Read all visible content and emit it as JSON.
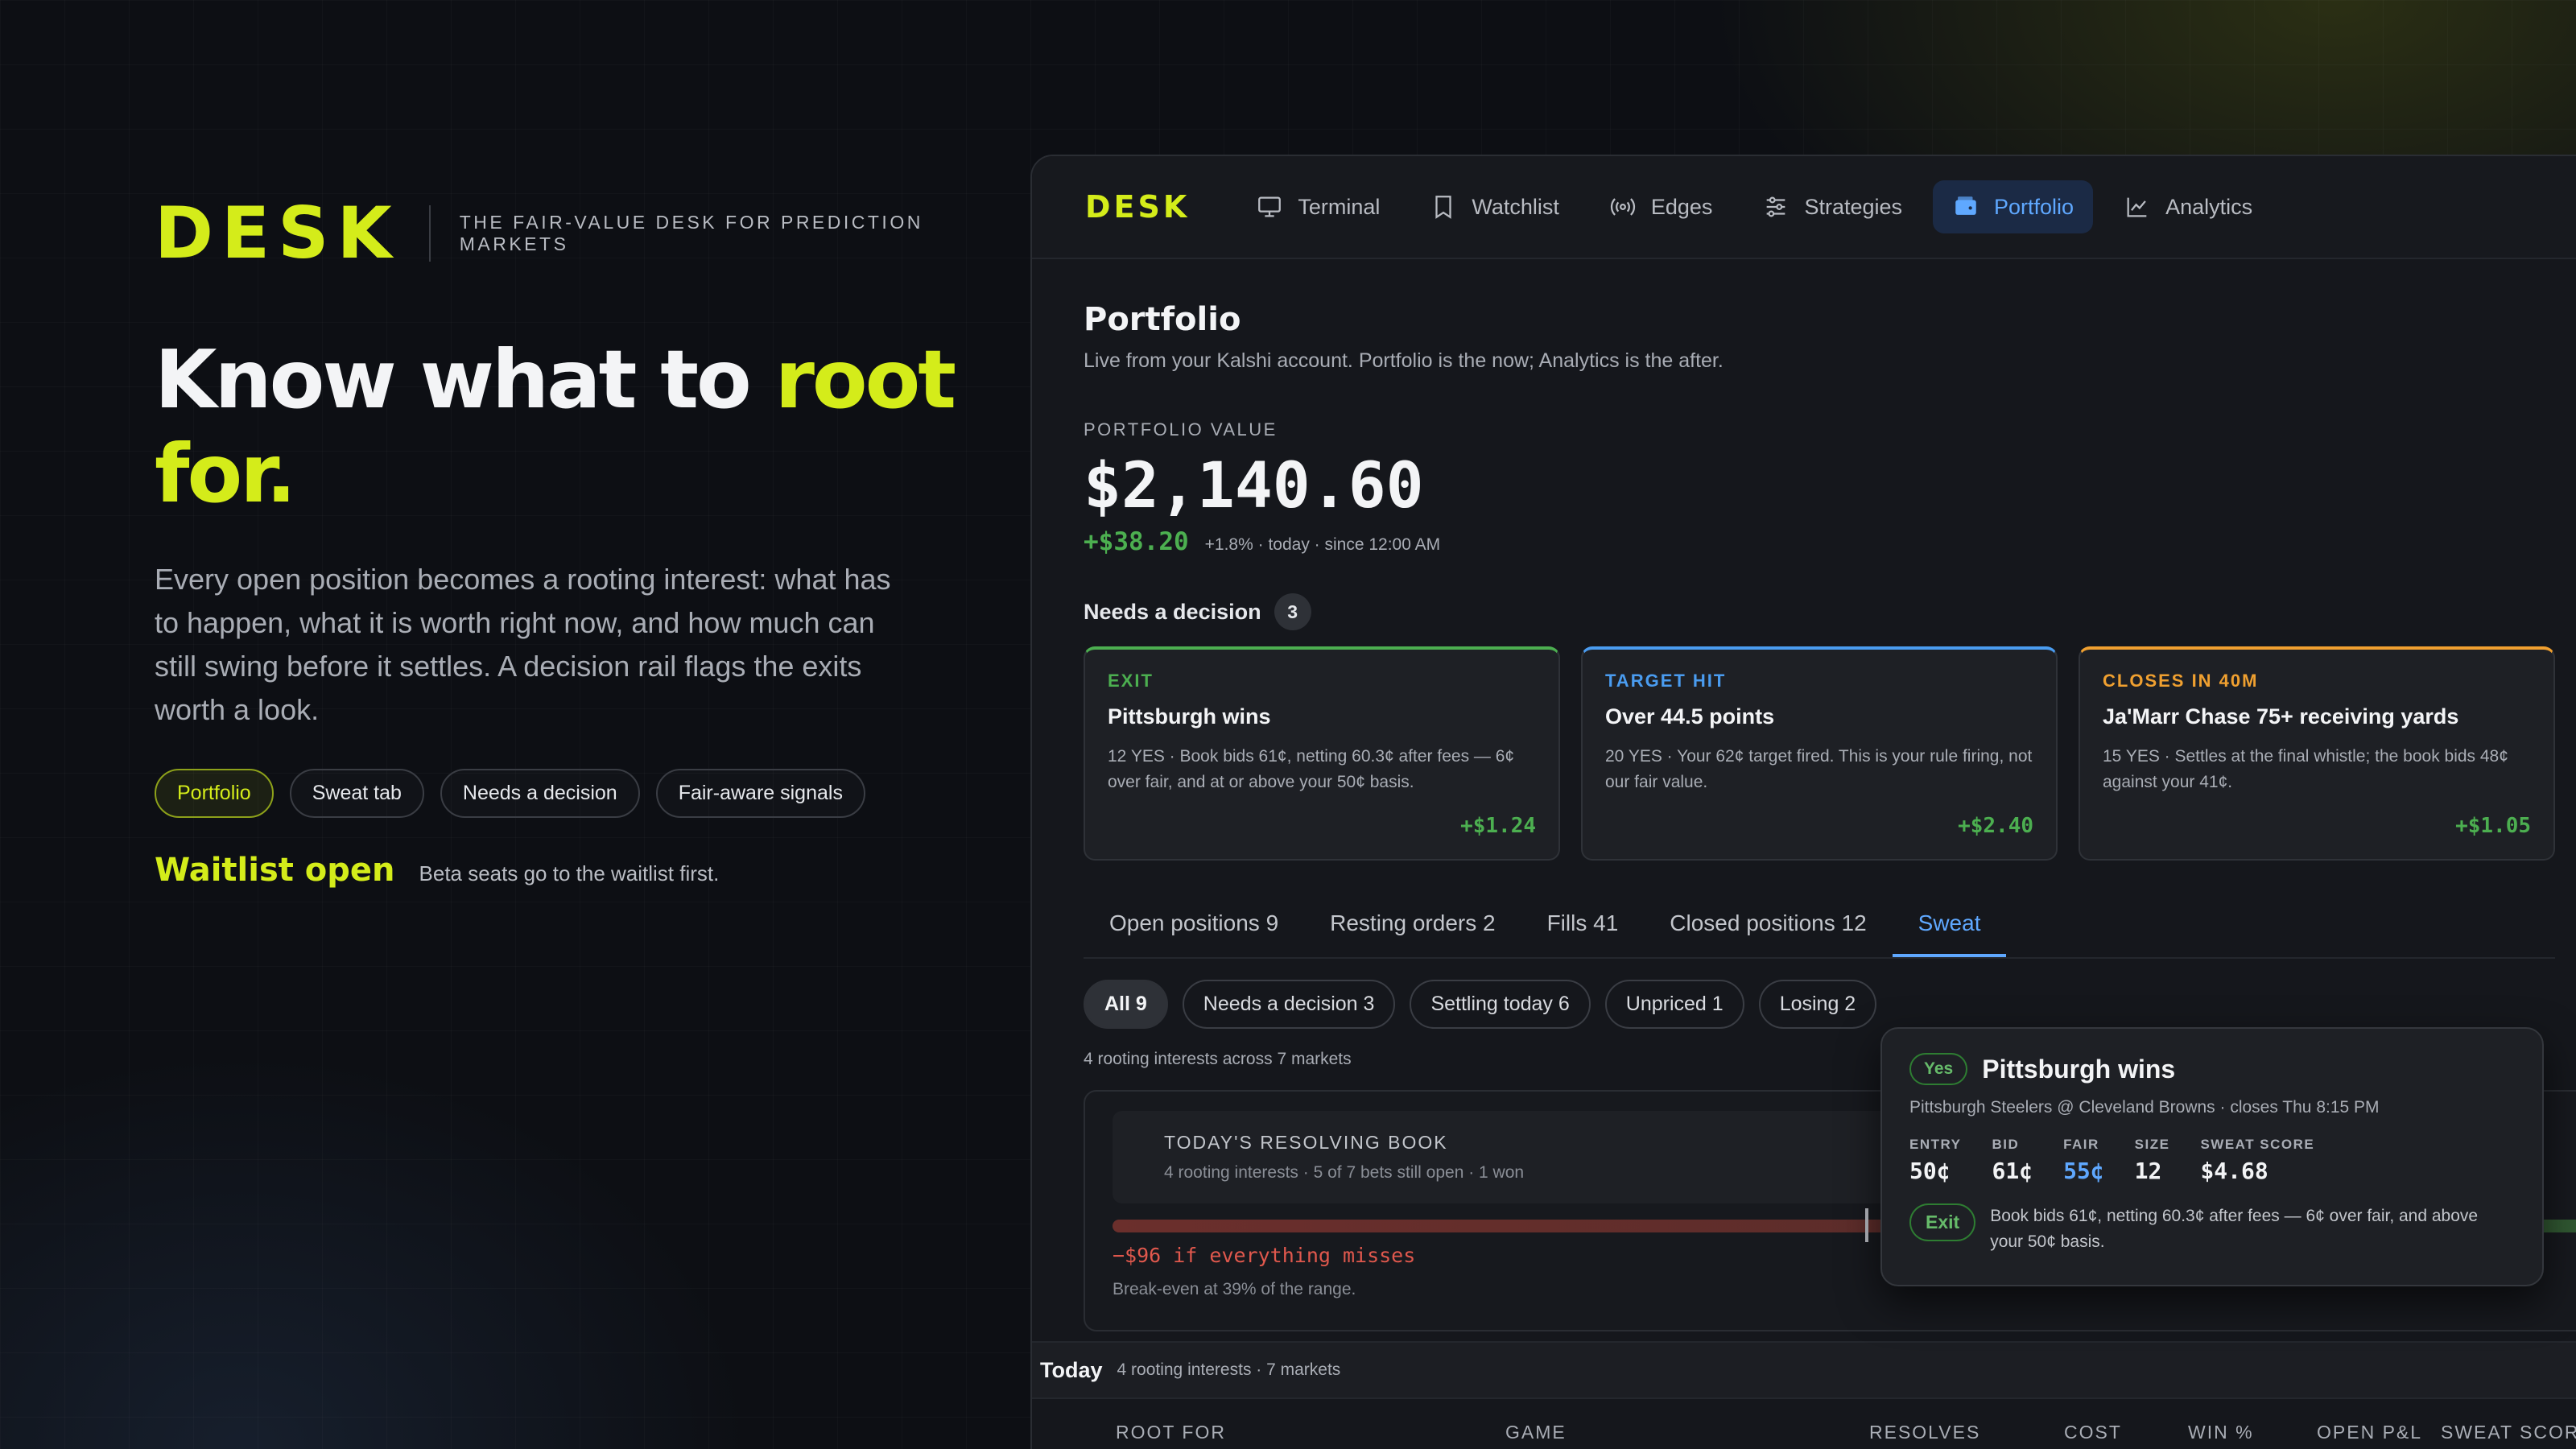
{
  "hero": {
    "logo": "DESK",
    "tagline": "THE FAIR-VALUE DESK FOR PREDICTION MARKETS",
    "headline_pre": "Know what to ",
    "headline_accent": "root for.",
    "description": "Every open position becomes a rooting interest: what has to happen, what it is worth right now, and how much can still swing before it settles. A decision rail flags the exits worth a look.",
    "chips": [
      "Portfolio",
      "Sweat tab",
      "Needs a decision",
      "Fair-aware signals"
    ],
    "waitlist_title": "Waitlist open",
    "waitlist_note": "Beta seats go to the waitlist first."
  },
  "nav": {
    "logo": "DESK",
    "items": [
      {
        "label": "Terminal",
        "icon": "monitor-icon"
      },
      {
        "label": "Watchlist",
        "icon": "bookmark-icon"
      },
      {
        "label": "Edges",
        "icon": "broadcast-icon"
      },
      {
        "label": "Strategies",
        "icon": "sliders-icon"
      },
      {
        "label": "Portfolio",
        "icon": "wallet-icon",
        "active": true
      },
      {
        "label": "Analytics",
        "icon": "chart-line-icon"
      }
    ]
  },
  "portfolio": {
    "title": "Portfolio",
    "subtitle": "Live from your Kalshi account. Portfolio is the now; Analytics is the after.",
    "value_label": "PORTFOLIO VALUE",
    "value": "$2,140.60",
    "change": "+$38.20",
    "change_meta": "+1.8% · today · since 12:00 AM",
    "needs_label": "Needs a decision",
    "needs_count": "3"
  },
  "cards": [
    {
      "kind": "EXIT",
      "color": "#4caf50",
      "title": "Pittsburgh wins",
      "desc": "12 YES · Book bids 61¢, netting 60.3¢ after fees — 6¢ over fair, and at or above your 50¢ basis.",
      "pnl": "+$1.24"
    },
    {
      "kind": "TARGET HIT",
      "color": "#4a9cf0",
      "title": "Over 44.5 points",
      "desc": "20 YES · Your 62¢ target fired. This is your rule firing, not our fair value.",
      "pnl": "+$2.40"
    },
    {
      "kind": "CLOSES IN 40M",
      "color": "#f0a030",
      "title": "Ja'Marr Chase 75+ receiving yards",
      "desc": "15 YES · Settles at the final whistle; the book bids 48¢ against your 41¢.",
      "pnl": "+$1.05"
    }
  ],
  "tabs": [
    "Open positions 9",
    "Resting orders 2",
    "Fills 41",
    "Closed positions 12",
    "Sweat"
  ],
  "filters": [
    "All 9",
    "Needs a decision 3",
    "Settling today 6",
    "Unpriced 1",
    "Losing 2"
  ],
  "meta": "4 rooting interests across 7 markets",
  "book": {
    "title": "TODAY'S RESOLVING BOOK",
    "sub": "4 rooting interests · 5 of 7 bets still open · 1 won",
    "miss": "−$96 if everything misses",
    "breakeven": "Break-even at 39% of the range.",
    "breakeven_fraction": 0.39
  },
  "today": {
    "label": "Today",
    "meta": "4 rooting interests · 7 markets"
  },
  "table_headers": [
    "ROOT FOR",
    "GAME",
    "RESOLVES",
    "COST",
    "WIN %",
    "OPEN P&L",
    "SWEAT SCORE"
  ],
  "popover": {
    "side": "Yes",
    "name": "Pittsburgh wins",
    "sub": "Pittsburgh Steelers @ Cleveland Browns · closes Thu 8:15 PM",
    "stats": [
      {
        "label": "ENTRY",
        "value": "50¢"
      },
      {
        "label": "BID",
        "value": "61¢"
      },
      {
        "label": "FAIR",
        "value": "55¢"
      },
      {
        "label": "SIZE",
        "value": "12"
      },
      {
        "label": "SWEAT SCORE",
        "value": "$4.68"
      }
    ],
    "action": "Exit",
    "action_text": "Book bids 61¢, netting 60.3¢ after fees — 6¢ over fair, and above your 50¢ basis."
  }
}
